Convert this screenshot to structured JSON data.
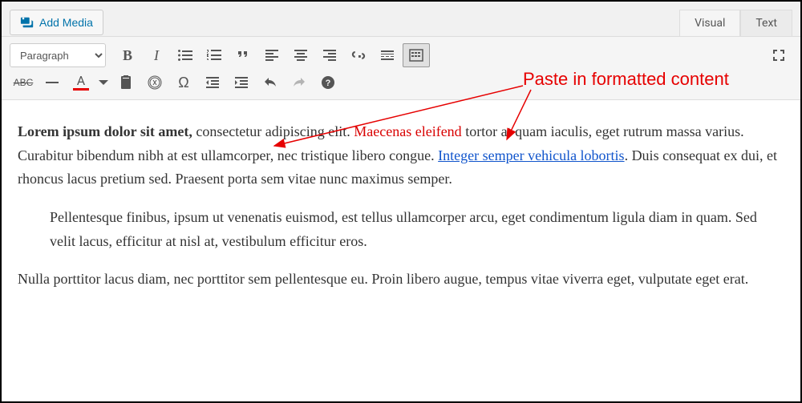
{
  "topbar": {
    "add_media": "Add Media"
  },
  "tabs": {
    "visual": "Visual",
    "text": "Text"
  },
  "toolbar": {
    "format_selected": "Paragraph"
  },
  "annotation": {
    "label": "Paste in formatted content"
  },
  "content": {
    "p1": {
      "bold": "Lorem ipsum dolor sit amet,",
      "t1": " consectetur adipiscing elit. ",
      "red": "Maecenas eleifend",
      "t2": " tortor at quam iaculis, eget rutrum massa varius. Curabitur bibendum nibh at est ullamcorper, nec tristique libero congue. ",
      "link": "Integer semper vehicula lobortis",
      "t3": ". Duis consequat ex dui, et rhoncus lacus pretium sed. Praesent porta sem vitae nunc maximus semper."
    },
    "blockquote": "Pellentesque finibus, ipsum ut venenatis euismod, est tellus ullamcorper arcu, eget condimentum ligula diam in quam. Sed velit lacus, efficitur at nisl at, vestibulum efficitur eros.",
    "p2": "Nulla porttitor lacus diam, nec porttitor sem pellentesque eu. Proin libero augue, tempus vitae viverra eget, vulputate eget erat."
  }
}
